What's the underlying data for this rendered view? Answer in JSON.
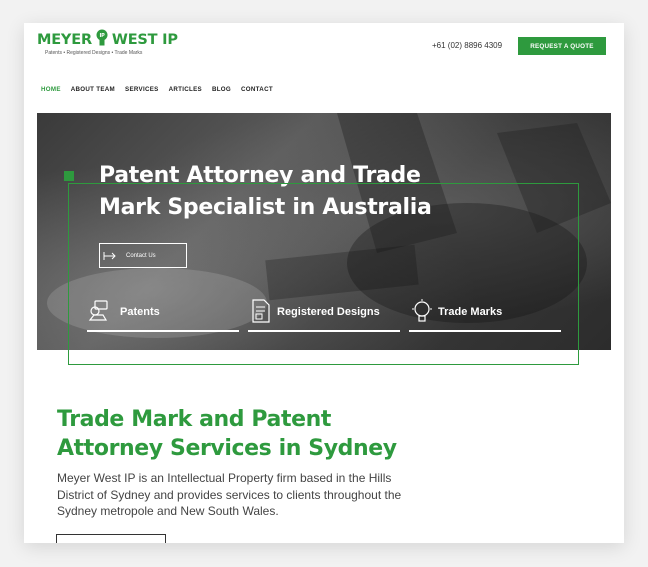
{
  "header": {
    "logo_main_left": "MEYER",
    "logo_main_right": "WEST IP",
    "logo_tagline": "Patents • Registered Designs • Trade Marks",
    "phone": "+61 (02) 8896 4309",
    "quote_button": "REQUEST A QUOTE"
  },
  "nav": {
    "items": [
      {
        "label": "HOME",
        "active": true
      },
      {
        "label": "ABOUT TEAM"
      },
      {
        "label": "SERVICES"
      },
      {
        "label": "ARTICLES"
      },
      {
        "label": "BLOG"
      },
      {
        "label": "CONTACT"
      }
    ]
  },
  "hero": {
    "title_line1": "Patent Attorney and Trade",
    "title_line2": "Mark Specialist in Australia",
    "contact_button": "Contact Us",
    "services": [
      {
        "label": "Patents",
        "icon": "patent-icon"
      },
      {
        "label": "Registered Designs",
        "icon": "registered-designs-icon"
      },
      {
        "label": "Trade Marks",
        "icon": "trade-mark-icon"
      }
    ]
  },
  "main": {
    "headline_line1": "Trade Mark and Patent",
    "headline_line2": "Attorney Services in Sydney",
    "intro_line1": "Meyer West IP is an Intellectual Property firm based in the Hills",
    "intro_line2": "District of Sydney and provides services to clients throughout the",
    "intro_line3": "Sydney metropole and New South Wales."
  },
  "colors": {
    "brand_green": "#2e9a3e",
    "text_dark": "#222222",
    "hero_overlay": "#3a3a3a"
  }
}
